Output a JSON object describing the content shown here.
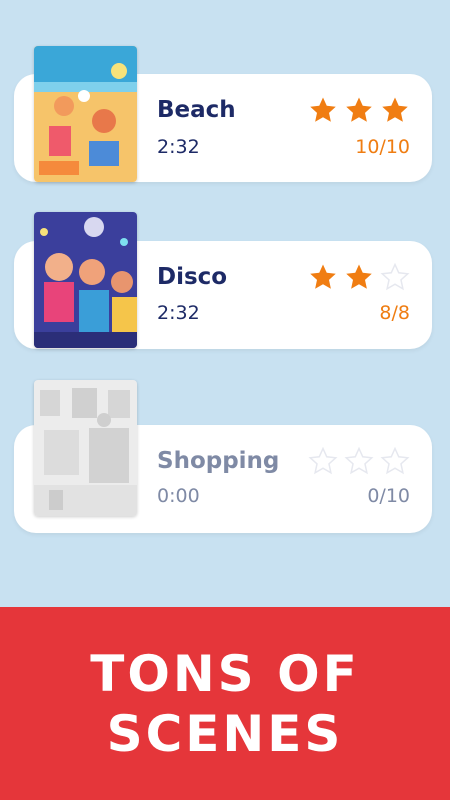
{
  "scenes": [
    {
      "title": "Beach",
      "time": "2:32",
      "count": "10/10",
      "stars": 3,
      "locked": false
    },
    {
      "title": "Disco",
      "time": "2:32",
      "count": "8/8",
      "stars": 2,
      "locked": false
    },
    {
      "title": "Shopping",
      "time": "0:00",
      "count": "0/10",
      "stars": 0,
      "locked": true
    }
  ],
  "banner": {
    "line1": "TONS OF",
    "line2": "SCENES"
  },
  "colors": {
    "background": "#c8e1f1",
    "title": "#1d2a66",
    "star_filled": "#f07d12",
    "count": "#ef7d12",
    "banner": "#e5363a"
  }
}
